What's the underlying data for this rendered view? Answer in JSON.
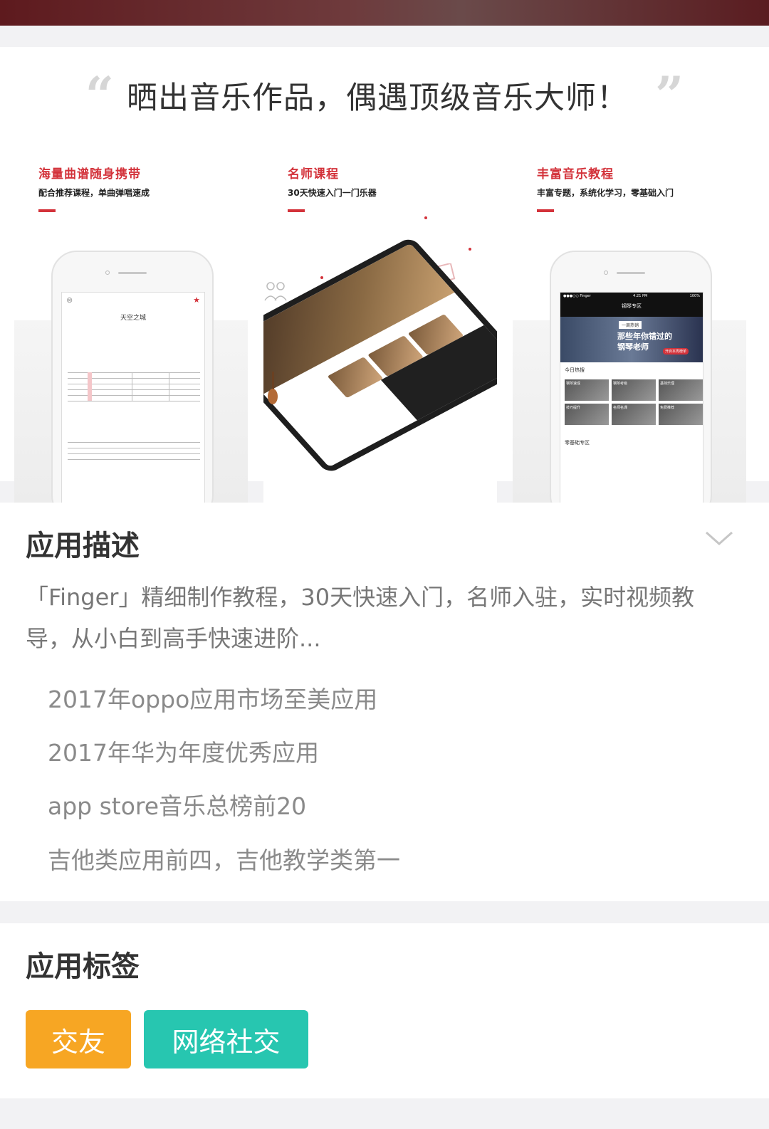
{
  "slogan": {
    "open_quote": "“",
    "text": "晒出音乐作品，偶遇顶级音乐大师！",
    "close_quote": "”"
  },
  "screenshots": [
    {
      "title": "海量曲谱随身携带",
      "subtitle": "配合推荐课程，单曲弹唱速成",
      "screen": {
        "song_title": "天空之城"
      }
    },
    {
      "title": "名师课程",
      "subtitle": "30天快速入门一门乐器"
    },
    {
      "title": "丰富音乐教程",
      "subtitle": "丰富专题，系统化学习，零基础入门",
      "screen": {
        "status_left": "●●●○○ Finger",
        "status_time": "4:21 PM",
        "status_right": "100%",
        "nav_title": "钢琴专区",
        "banner_tag": "一周热销",
        "banner_line1": "那些年你错过的",
        "banner_line2": "钢琴老师",
        "banner_button": "开启本周榜单",
        "hot_label": "今日热搜",
        "tiles": [
          "钢琴速成",
          "钢琴考级",
          "基础乐理",
          "技巧提升",
          "名师名课",
          "免费推荐"
        ],
        "zero_label": "零基础专区"
      }
    }
  ],
  "description": {
    "heading": "应用描述",
    "text": "「Finger」精细制作教程，30天快速入门，名师入驻，实时视频教导，从小白到高手快速进阶...",
    "awards": [
      "2017年oppo应用市场至美应用",
      "2017年华为年度优秀应用",
      "app store音乐总榜前20",
      "吉他类应用前四，吉他教学类第一"
    ]
  },
  "tags": {
    "heading": "应用标签",
    "items": [
      {
        "label": "交友",
        "color": "#f7a623"
      },
      {
        "label": "网络社交",
        "color": "#27c6b0"
      }
    ]
  },
  "colors": {
    "accent_red": "#d3323a",
    "page_bg": "#f2f2f4",
    "banner_dark": "#5e1a1e"
  }
}
